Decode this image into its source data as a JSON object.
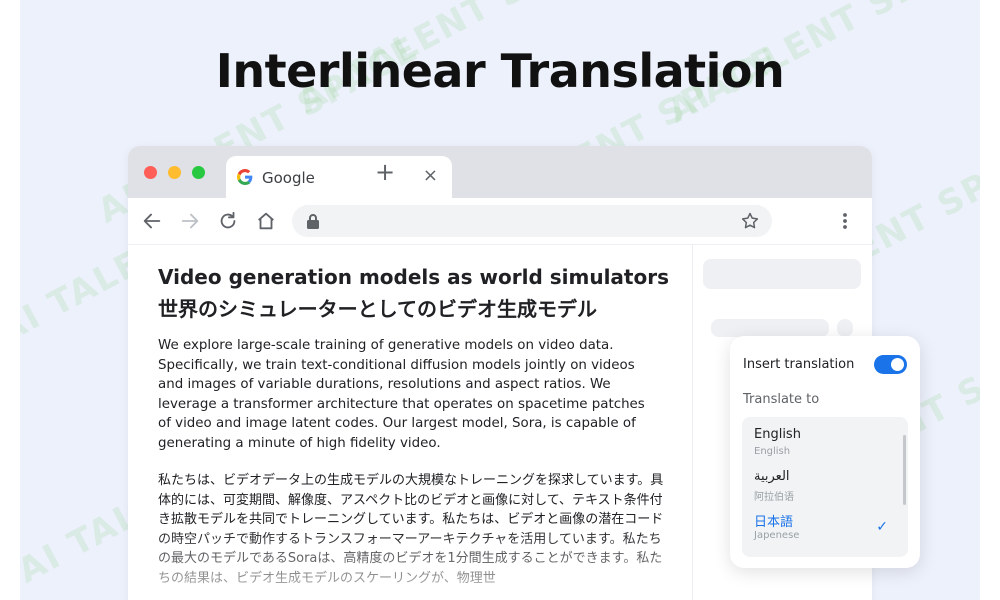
{
  "headline": "Interlinear Translation",
  "watermark_text": "AI TALENT SPACE",
  "browser": {
    "tab": {
      "title": "Google",
      "close_glyph": "×",
      "icon": "google-g-icon"
    },
    "new_tab_glyph": "+",
    "traffic_lights": [
      "#ff5f57",
      "#febc2e",
      "#28c840"
    ]
  },
  "article": {
    "title_en": "Video generation models as world simulators",
    "title_ja": "世界のシミュレーターとしてのビデオ生成モデル",
    "paragraph_en": "We explore large-scale training of generative models on video data. Specifically, we train text-conditional diffusion models jointly on videos and images of variable durations, resolutions and aspect ratios. We leverage a transformer architecture that operates on spacetime patches of video and image latent codes. Our largest model, Sora, is capable of generating a minute of high fidelity video.",
    "paragraph_ja": "私たちは、ビデオデータ上の生成モデルの大規模なトレーニングを探求しています。具体的には、可変期間、解像度、アスペクト比のビデオと画像に対して、テキスト条件付き拡散モデルを共同でトレーニングしています。私たちは、ビデオと画像の潜在コードの時空パッチで動作するトランスフォーマーアーキテクチャを活用しています。私たちの最大のモデルであるSoraは、高精度のビデオを1分間生成することができます。私たちの結果は、ビデオ生成モデルのスケーリングが、物理世"
  },
  "panel": {
    "insert_label": "Insert translation",
    "toggle_on": true,
    "translate_to_label": "Translate to",
    "languages": [
      {
        "name": "English",
        "sub": "English",
        "selected": false
      },
      {
        "name": "العربية",
        "sub": "阿拉伯语",
        "selected": false
      },
      {
        "name": "日本語",
        "sub": "Japenese",
        "selected": true
      }
    ],
    "check_glyph": "✓"
  },
  "colors": {
    "accent": "#1a73e8",
    "background": "#edf1fb"
  }
}
